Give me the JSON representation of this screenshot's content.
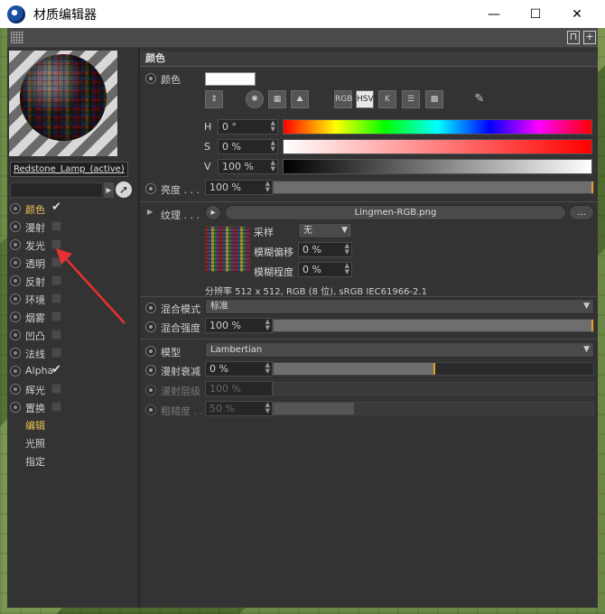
{
  "window": {
    "title": "材质编辑器",
    "minimize": "—",
    "maximize": "☐",
    "close": "✕"
  },
  "material": {
    "name": "Redstone_Lamp_(active)"
  },
  "channels": [
    {
      "label": "颜色",
      "checked": true,
      "active": true
    },
    {
      "label": "漫射",
      "checked": false
    },
    {
      "label": "发光",
      "checked": false
    },
    {
      "label": "透明",
      "checked": false
    },
    {
      "label": "反射",
      "checked": false
    },
    {
      "label": "环境",
      "checked": false
    },
    {
      "label": "烟雾",
      "checked": false
    },
    {
      "label": "凹凸",
      "checked": false
    },
    {
      "label": "法线",
      "checked": false
    },
    {
      "label": "Alpha",
      "checked": true
    },
    {
      "label": "辉光",
      "checked": false
    },
    {
      "label": "置换",
      "checked": false
    }
  ],
  "sublinks": [
    "编辑",
    "光照",
    "指定"
  ],
  "section": {
    "title": "颜色"
  },
  "color": {
    "label": "颜色",
    "swatch": "#ffffff",
    "modes": [
      "RGB",
      "HSV",
      "K"
    ],
    "h_label": "H",
    "h_value": "0 °",
    "s_label": "S",
    "s_value": "0 %",
    "v_label": "V",
    "v_value": "100 %"
  },
  "brightness": {
    "label": "亮度 . . .",
    "value": "100 %",
    "fill": 1.0
  },
  "texture": {
    "label": "纹理 . . .",
    "file": "Lingmen-RGB.png",
    "more": "...",
    "sampling_label": "采样",
    "sampling_value": "无",
    "blur_offset_label": "模糊偏移",
    "blur_offset_value": "0 %",
    "blur_scale_label": "模糊程度",
    "blur_scale_value": "0 %",
    "info": "分辨率 512 x 512, RGB (8 位), sRGB IEC61966-2.1"
  },
  "mix_mode": {
    "label": "混合模式",
    "value": "标准"
  },
  "mix_strength": {
    "label": "混合强度",
    "value": "100 %",
    "fill": 1.0
  },
  "model": {
    "label": "模型",
    "value": "Lambertian"
  },
  "diffuse_falloff": {
    "label": "漫射衰减",
    "value": "0 %",
    "fill": 0.5
  },
  "diffuse_level": {
    "label": "漫射层级",
    "value": "100 %"
  },
  "roughness": {
    "label": "粗糙度 . .",
    "value": "50 %",
    "fill": 0.25
  },
  "colors": {
    "accent": "#e8c25a",
    "panel": "#333333",
    "marker": "#e0a020"
  }
}
